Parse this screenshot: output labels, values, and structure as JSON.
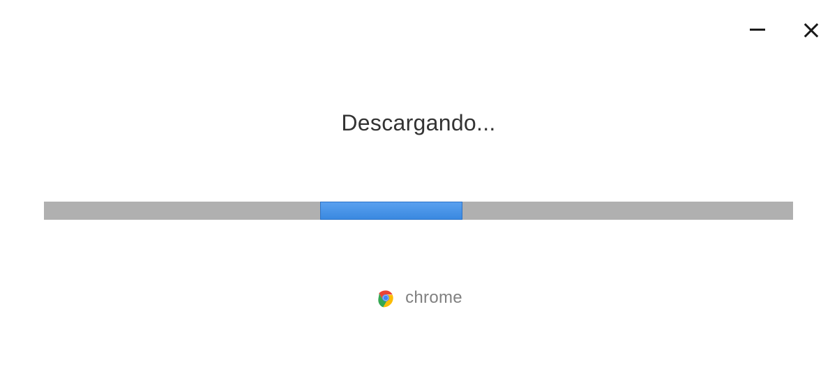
{
  "status": {
    "text": "Descargando..."
  },
  "progress": {
    "left_percent": 36.9,
    "width_percent": 19.0
  },
  "branding": {
    "label": "chrome"
  }
}
